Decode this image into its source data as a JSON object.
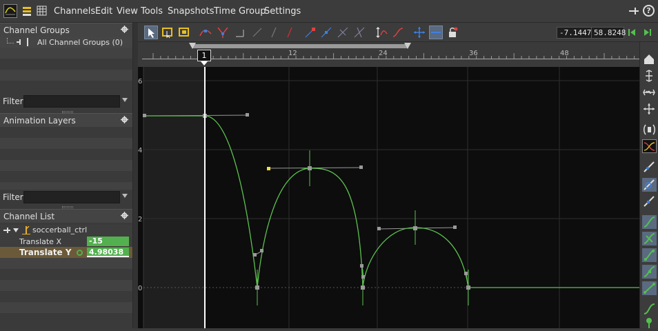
{
  "menubar": {
    "items": [
      "Channels",
      "Edit",
      "View",
      "Tools",
      "Snapshots",
      "Time Group",
      "Settings"
    ],
    "help_glyph": "?"
  },
  "left_panel": {
    "channel_groups": {
      "header": "Channel Groups",
      "items": [
        "All Channel Groups (0)"
      ]
    },
    "filter_label": "Filter",
    "animation_layers": {
      "header": "Animation Layers"
    },
    "channel_list": {
      "header": "Channel List",
      "node": "soccerball_ctrl",
      "channels": [
        {
          "name": "Translate X",
          "value": "-15",
          "selected": false
        },
        {
          "name": "Translate Y",
          "value": "4.98038",
          "selected": true
        }
      ]
    }
  },
  "toolbar": {
    "coord_x": "-7.1447",
    "coord_y": "58.8248",
    "tools": [
      "select-tool",
      "box-select-tool",
      "box-scale-tool",
      "curve-tool",
      "split-tool",
      "flat-tool",
      "linear-tool",
      "slope-tool",
      "cut-tool",
      "key-tool",
      "insert-key-tool",
      "bezier-tool",
      "tangent-tool",
      "retime-tool",
      "ease-tool",
      "move-tool",
      "snap-tool",
      "lock-tool"
    ]
  },
  "ruler": {
    "frame_marker": "1",
    "ticks": [
      "12",
      "24",
      "36",
      "48"
    ]
  },
  "graph": {
    "y_labels": [
      "6",
      "4",
      "2",
      "0"
    ],
    "curve_color": "#5cc24f",
    "key_color": "#9a9a9a",
    "selected_handle_color": "#f0e040",
    "playhead_color": "#ffffff"
  },
  "colors": {
    "accent_green": "#53b04e",
    "selected_row": "#6b5a3a",
    "panel_bg": "#3a3a3a"
  }
}
